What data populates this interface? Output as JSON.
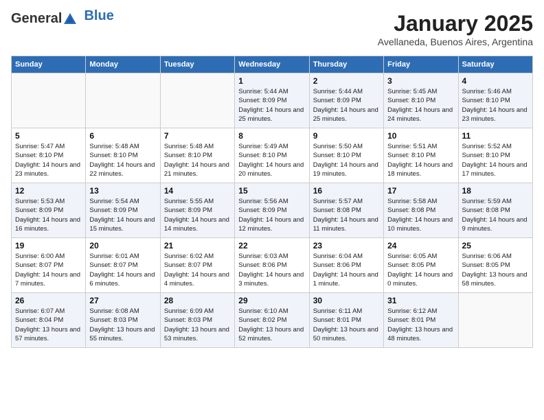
{
  "logo": {
    "general": "General",
    "blue": "Blue"
  },
  "header": {
    "month": "January 2025",
    "location": "Avellaneda, Buenos Aires, Argentina"
  },
  "weekdays": [
    "Sunday",
    "Monday",
    "Tuesday",
    "Wednesday",
    "Thursday",
    "Friday",
    "Saturday"
  ],
  "weeks": [
    [
      {
        "day": "",
        "sunrise": "",
        "sunset": "",
        "daylight": ""
      },
      {
        "day": "",
        "sunrise": "",
        "sunset": "",
        "daylight": ""
      },
      {
        "day": "",
        "sunrise": "",
        "sunset": "",
        "daylight": ""
      },
      {
        "day": "1",
        "sunrise": "Sunrise: 5:44 AM",
        "sunset": "Sunset: 8:09 PM",
        "daylight": "Daylight: 14 hours and 25 minutes."
      },
      {
        "day": "2",
        "sunrise": "Sunrise: 5:44 AM",
        "sunset": "Sunset: 8:09 PM",
        "daylight": "Daylight: 14 hours and 25 minutes."
      },
      {
        "day": "3",
        "sunrise": "Sunrise: 5:45 AM",
        "sunset": "Sunset: 8:10 PM",
        "daylight": "Daylight: 14 hours and 24 minutes."
      },
      {
        "day": "4",
        "sunrise": "Sunrise: 5:46 AM",
        "sunset": "Sunset: 8:10 PM",
        "daylight": "Daylight: 14 hours and 23 minutes."
      }
    ],
    [
      {
        "day": "5",
        "sunrise": "Sunrise: 5:47 AM",
        "sunset": "Sunset: 8:10 PM",
        "daylight": "Daylight: 14 hours and 23 minutes."
      },
      {
        "day": "6",
        "sunrise": "Sunrise: 5:48 AM",
        "sunset": "Sunset: 8:10 PM",
        "daylight": "Daylight: 14 hours and 22 minutes."
      },
      {
        "day": "7",
        "sunrise": "Sunrise: 5:48 AM",
        "sunset": "Sunset: 8:10 PM",
        "daylight": "Daylight: 14 hours and 21 minutes."
      },
      {
        "day": "8",
        "sunrise": "Sunrise: 5:49 AM",
        "sunset": "Sunset: 8:10 PM",
        "daylight": "Daylight: 14 hours and 20 minutes."
      },
      {
        "day": "9",
        "sunrise": "Sunrise: 5:50 AM",
        "sunset": "Sunset: 8:10 PM",
        "daylight": "Daylight: 14 hours and 19 minutes."
      },
      {
        "day": "10",
        "sunrise": "Sunrise: 5:51 AM",
        "sunset": "Sunset: 8:10 PM",
        "daylight": "Daylight: 14 hours and 18 minutes."
      },
      {
        "day": "11",
        "sunrise": "Sunrise: 5:52 AM",
        "sunset": "Sunset: 8:10 PM",
        "daylight": "Daylight: 14 hours and 17 minutes."
      }
    ],
    [
      {
        "day": "12",
        "sunrise": "Sunrise: 5:53 AM",
        "sunset": "Sunset: 8:09 PM",
        "daylight": "Daylight: 14 hours and 16 minutes."
      },
      {
        "day": "13",
        "sunrise": "Sunrise: 5:54 AM",
        "sunset": "Sunset: 8:09 PM",
        "daylight": "Daylight: 14 hours and 15 minutes."
      },
      {
        "day": "14",
        "sunrise": "Sunrise: 5:55 AM",
        "sunset": "Sunset: 8:09 PM",
        "daylight": "Daylight: 14 hours and 14 minutes."
      },
      {
        "day": "15",
        "sunrise": "Sunrise: 5:56 AM",
        "sunset": "Sunset: 8:09 PM",
        "daylight": "Daylight: 14 hours and 12 minutes."
      },
      {
        "day": "16",
        "sunrise": "Sunrise: 5:57 AM",
        "sunset": "Sunset: 8:08 PM",
        "daylight": "Daylight: 14 hours and 11 minutes."
      },
      {
        "day": "17",
        "sunrise": "Sunrise: 5:58 AM",
        "sunset": "Sunset: 8:08 PM",
        "daylight": "Daylight: 14 hours and 10 minutes."
      },
      {
        "day": "18",
        "sunrise": "Sunrise: 5:59 AM",
        "sunset": "Sunset: 8:08 PM",
        "daylight": "Daylight: 14 hours and 9 minutes."
      }
    ],
    [
      {
        "day": "19",
        "sunrise": "Sunrise: 6:00 AM",
        "sunset": "Sunset: 8:07 PM",
        "daylight": "Daylight: 14 hours and 7 minutes."
      },
      {
        "day": "20",
        "sunrise": "Sunrise: 6:01 AM",
        "sunset": "Sunset: 8:07 PM",
        "daylight": "Daylight: 14 hours and 6 minutes."
      },
      {
        "day": "21",
        "sunrise": "Sunrise: 6:02 AM",
        "sunset": "Sunset: 8:07 PM",
        "daylight": "Daylight: 14 hours and 4 minutes."
      },
      {
        "day": "22",
        "sunrise": "Sunrise: 6:03 AM",
        "sunset": "Sunset: 8:06 PM",
        "daylight": "Daylight: 14 hours and 3 minutes."
      },
      {
        "day": "23",
        "sunrise": "Sunrise: 6:04 AM",
        "sunset": "Sunset: 8:06 PM",
        "daylight": "Daylight: 14 hours and 1 minute."
      },
      {
        "day": "24",
        "sunrise": "Sunrise: 6:05 AM",
        "sunset": "Sunset: 8:05 PM",
        "daylight": "Daylight: 14 hours and 0 minutes."
      },
      {
        "day": "25",
        "sunrise": "Sunrise: 6:06 AM",
        "sunset": "Sunset: 8:05 PM",
        "daylight": "Daylight: 13 hours and 58 minutes."
      }
    ],
    [
      {
        "day": "26",
        "sunrise": "Sunrise: 6:07 AM",
        "sunset": "Sunset: 8:04 PM",
        "daylight": "Daylight: 13 hours and 57 minutes."
      },
      {
        "day": "27",
        "sunrise": "Sunrise: 6:08 AM",
        "sunset": "Sunset: 8:03 PM",
        "daylight": "Daylight: 13 hours and 55 minutes."
      },
      {
        "day": "28",
        "sunrise": "Sunrise: 6:09 AM",
        "sunset": "Sunset: 8:03 PM",
        "daylight": "Daylight: 13 hours and 53 minutes."
      },
      {
        "day": "29",
        "sunrise": "Sunrise: 6:10 AM",
        "sunset": "Sunset: 8:02 PM",
        "daylight": "Daylight: 13 hours and 52 minutes."
      },
      {
        "day": "30",
        "sunrise": "Sunrise: 6:11 AM",
        "sunset": "Sunset: 8:01 PM",
        "daylight": "Daylight: 13 hours and 50 minutes."
      },
      {
        "day": "31",
        "sunrise": "Sunrise: 6:12 AM",
        "sunset": "Sunset: 8:01 PM",
        "daylight": "Daylight: 13 hours and 48 minutes."
      },
      {
        "day": "",
        "sunrise": "",
        "sunset": "",
        "daylight": ""
      }
    ]
  ]
}
